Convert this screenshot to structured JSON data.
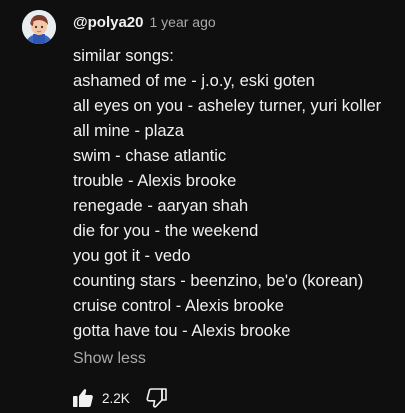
{
  "comment": {
    "author": "@polya20",
    "timestamp": "1 year ago",
    "lines": [
      "similar songs:",
      "ashamed of me - j.o.y, eski goten",
      "all eyes on you - asheley turner, yuri koller",
      "all mine - plaza",
      "swim - chase atlantic",
      "trouble - Alexis brooke",
      "renegade - aaryan shah",
      "die for you - the weekend",
      "you got it - vedo",
      "counting stars - beenzino, be'o (korean)",
      "cruise control - Alexis brooke",
      "gotta have tou - Alexis brooke"
    ],
    "show_less_label": "Show less"
  },
  "actions": {
    "like_icon": "thumbs-up-icon",
    "like_count": "2.2K",
    "dislike_icon": "thumbs-down-icon"
  },
  "colors": {
    "background": "#0f0f0f",
    "text_primary": "#f1f1f1",
    "text_secondary": "#aaaaaa"
  }
}
